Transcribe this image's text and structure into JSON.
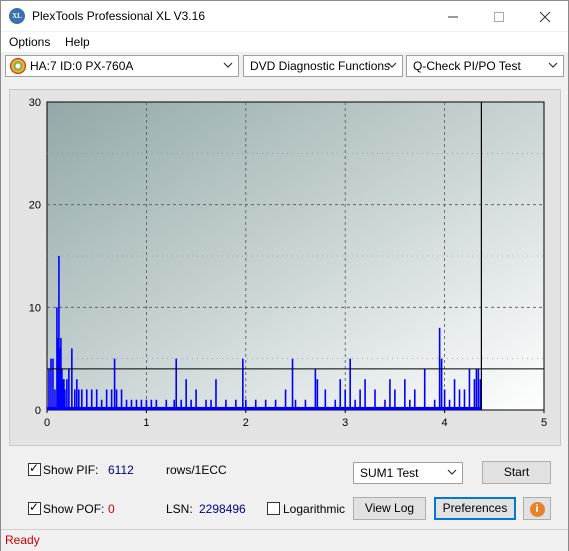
{
  "window": {
    "title": "PlexTools Professional XL V3.16",
    "app_icon_text": "XL"
  },
  "menu": [
    {
      "label": "Options",
      "accel": "O"
    },
    {
      "label": "Help",
      "accel": "H"
    }
  ],
  "toolbar": {
    "drive": "HA:7 ID:0  PX-760A",
    "function": "DVD Diagnostic Functions",
    "test": "Q-Check PI/PO Test"
  },
  "chart_data": {
    "type": "bar",
    "xlabel": "",
    "ylabel": "",
    "xlim": [
      0,
      5
    ],
    "ylim": [
      0,
      30
    ],
    "x_ticks": [
      "0",
      "1",
      "2",
      "3",
      "4",
      "5"
    ],
    "y_ticks": [
      "0",
      "10",
      "20",
      "30"
    ],
    "threshold": 4,
    "marker_x": 4.37,
    "grid": true,
    "series": [
      {
        "color": "#0000ff",
        "x": [
          0.02,
          0.04,
          0.06,
          0.08,
          0.1,
          0.11,
          0.12,
          0.13,
          0.14,
          0.15,
          0.16,
          0.17,
          0.18,
          0.2,
          0.22,
          0.25,
          0.28,
          0.3,
          0.32,
          0.35,
          0.4,
          0.45,
          0.5,
          0.55,
          0.6,
          0.65,
          0.68,
          0.7,
          0.75,
          0.8,
          0.85,
          0.9,
          0.95,
          1.0,
          1.05,
          1.1,
          1.2,
          1.28,
          1.3,
          1.35,
          1.4,
          1.45,
          1.5,
          1.6,
          1.65,
          1.7,
          1.8,
          1.9,
          1.97,
          2.0,
          2.1,
          2.2,
          2.3,
          2.4,
          2.47,
          2.5,
          2.6,
          2.7,
          2.72,
          2.8,
          2.9,
          2.95,
          3.0,
          3.05,
          3.1,
          3.15,
          3.2,
          3.3,
          3.4,
          3.45,
          3.5,
          3.6,
          3.65,
          3.7,
          3.8,
          3.9,
          3.95,
          3.97,
          4.0,
          4.05,
          4.1,
          4.15,
          4.2,
          4.25,
          4.3,
          4.32,
          4.34,
          4.36
        ],
        "values": [
          4,
          5,
          5,
          2,
          10,
          7,
          15,
          6,
          7,
          4,
          3,
          3,
          2,
          3,
          4,
          6,
          2,
          3,
          2,
          2,
          2,
          2,
          2,
          1,
          2,
          2,
          5,
          2,
          2,
          1,
          1,
          1,
          1,
          1,
          1,
          1,
          1,
          1,
          5,
          1,
          3,
          1,
          2,
          1,
          1,
          3,
          1,
          1,
          5,
          1,
          1,
          1,
          1,
          2,
          5,
          1,
          1,
          4,
          3,
          2,
          1,
          3,
          2,
          5,
          1,
          2,
          3,
          2,
          1,
          3,
          2,
          3,
          1,
          2,
          4,
          1,
          8,
          5,
          2,
          1,
          3,
          2,
          2,
          4,
          3,
          4,
          4,
          3
        ]
      }
    ]
  },
  "controls": {
    "show_pif_label": "Show PIF:",
    "show_pif_checked": true,
    "pif_value": "6112",
    "pif_unit": "rows/1ECC",
    "show_pof_label": "Show POF:",
    "show_pof_checked": true,
    "pof_value": "0",
    "lsn_label": "LSN:",
    "lsn_value": "2298496",
    "logarithmic_label": "Logarithmic",
    "logarithmic_checked": false,
    "sum_select": "SUM1 Test",
    "start_label": "Start",
    "view_log_label": "View Log",
    "preferences_label": "Preferences",
    "info_icon": "i"
  },
  "status": {
    "text": "Ready"
  }
}
